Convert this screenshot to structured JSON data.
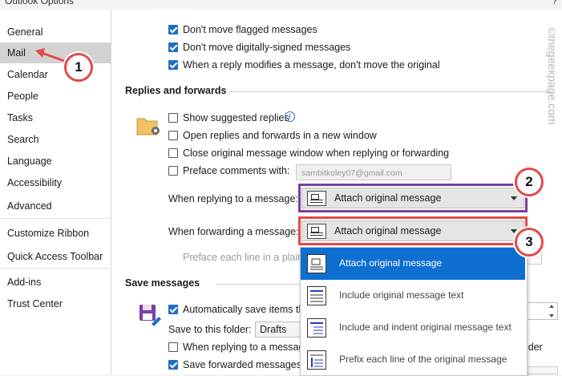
{
  "window": {
    "title": "Outlook Options",
    "help": "?"
  },
  "sidebar": {
    "items": [
      {
        "label": "General"
      },
      {
        "label": "Mail",
        "selected": true
      },
      {
        "label": "Calendar"
      },
      {
        "label": "People"
      },
      {
        "label": "Tasks"
      },
      {
        "label": "Search"
      },
      {
        "label": "Language"
      },
      {
        "label": "Accessibility"
      },
      {
        "label": "Advanced"
      },
      {
        "label": "Customize Ribbon"
      },
      {
        "label": "Quick Access Toolbar"
      },
      {
        "label": "Add-ins"
      },
      {
        "label": "Trust Center"
      }
    ]
  },
  "top_options": [
    {
      "label": "Don't move flagged messages",
      "checked": true
    },
    {
      "label": "Don't move digitally-signed messages",
      "checked": true
    },
    {
      "label": "When a reply modifies a message, don't move the original",
      "checked": true
    }
  ],
  "replies": {
    "section_title": "Replies and forwards",
    "options": [
      {
        "label": "Show suggested replies",
        "checked": false,
        "info_icon": "i"
      },
      {
        "label": "Open replies and forwards in a new window",
        "checked": false
      },
      {
        "label": "Close original message window when replying or forwarding",
        "checked": false
      },
      {
        "label": "Preface comments with:",
        "checked": false
      }
    ],
    "preface_value": "sambitkoley07@gmail.com",
    "reply_label": "When replying to a message:",
    "reply_value": "Attach original message",
    "forward_label": "When forwarding a message:",
    "forward_value": "Attach original message",
    "preface_line_label": "Preface each line in a plain-"
  },
  "dropdown": {
    "options": [
      {
        "label": "Attach original message",
        "selected": true
      },
      {
        "label": "Include original message text",
        "selected": false
      },
      {
        "label": "Include and indent original message text",
        "selected": false
      },
      {
        "label": "Prefix each line of the original message",
        "selected": false
      }
    ]
  },
  "save": {
    "section_title": "Save messages",
    "auto_save_label": "Automatically save items th",
    "auto_save_checked": true,
    "folder_label": "Save to this folder:",
    "folder_value": "Drafts",
    "when_replying_label": "When replying to a message",
    "when_replying_checked": false,
    "folder_suffix": "lder",
    "save_forwarded_label": "Save forwarded messages",
    "save_forwarded_checked": true
  },
  "callouts": [
    "1",
    "2",
    "3"
  ],
  "watermark": "©thegeekpage.com",
  "colors": {
    "accent": "#1f6fc5",
    "selected_row": "#0f6fd0",
    "callout_red": "#e34a4a",
    "purple_highlight": "#7b3fa0",
    "red_highlight": "#e34a4a"
  }
}
